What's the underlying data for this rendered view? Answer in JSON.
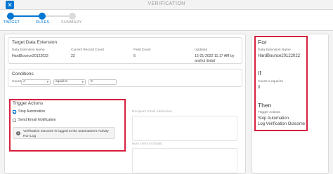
{
  "window": {
    "title": "VERIFICATION",
    "close_icon": "close-icon"
  },
  "stepper": {
    "steps": [
      {
        "label": "TARGET",
        "state": "complete"
      },
      {
        "label": "RULES",
        "state": "complete"
      },
      {
        "label": "SUMMARY",
        "state": "upcoming"
      }
    ],
    "active_color": "#0176d3",
    "inactive_color": "#dddbda"
  },
  "target": {
    "title": "Target Data Extension",
    "columns": [
      "Data Extension Name",
      "Current Record Count",
      "Field Count",
      "Updated"
    ],
    "values": [
      "HardBounce20122022",
      "22",
      "6",
      "12-21-2022 11:17 AM by anshul jindal"
    ]
  },
  "conditions": {
    "title": "Conditions",
    "field": "Count",
    "field_value": "A",
    "operator": "equal to",
    "value": "0"
  },
  "trigger": {
    "title": "Trigger Actions",
    "stop_automation": {
      "label": "Stop Automation",
      "checked": true
    },
    "send_email": {
      "label": "Send Email Notification",
      "checked": false
    },
    "info_text": "Verification outcome is logged to the automation's Activity Run Log",
    "info_icon": "info-icon"
  },
  "email": {
    "recipient_label": "Recipient Email Addresses",
    "note_label": "Note (Sent in Email)"
  },
  "summary": {
    "for_heading": "For",
    "for_label": "Data Extension Name",
    "for_value": "HardBounce20122022",
    "if_heading": "If",
    "if_label": "Count is equal to",
    "if_value": "0",
    "then_heading": "Then",
    "then_label": "Trigger Actions",
    "then_values": [
      "Stop Automation",
      "Log Verification Outcome"
    ]
  },
  "highlight_color": "#d6213d"
}
